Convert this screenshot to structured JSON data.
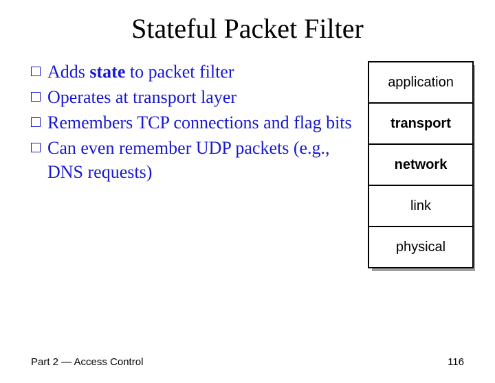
{
  "title": "Stateful Packet Filter",
  "bullets": [
    {
      "pre": "Adds ",
      "bold": "state",
      "post": " to packet filter"
    },
    {
      "pre": "Operates at transport layer",
      "bold": "",
      "post": ""
    },
    {
      "pre": "Remembers TCP connections and flag bits",
      "bold": "",
      "post": ""
    },
    {
      "pre": "Can even remember UDP packets (e.g., DNS requests)",
      "bold": "",
      "post": ""
    }
  ],
  "stack": {
    "layers": [
      {
        "label": "application",
        "bold": false
      },
      {
        "label": "transport",
        "bold": true
      },
      {
        "label": "network",
        "bold": true
      },
      {
        "label": "link",
        "bold": false
      },
      {
        "label": "physical",
        "bold": false
      }
    ]
  },
  "footer": {
    "left": "Part 2 — Access Control",
    "right": "116"
  }
}
